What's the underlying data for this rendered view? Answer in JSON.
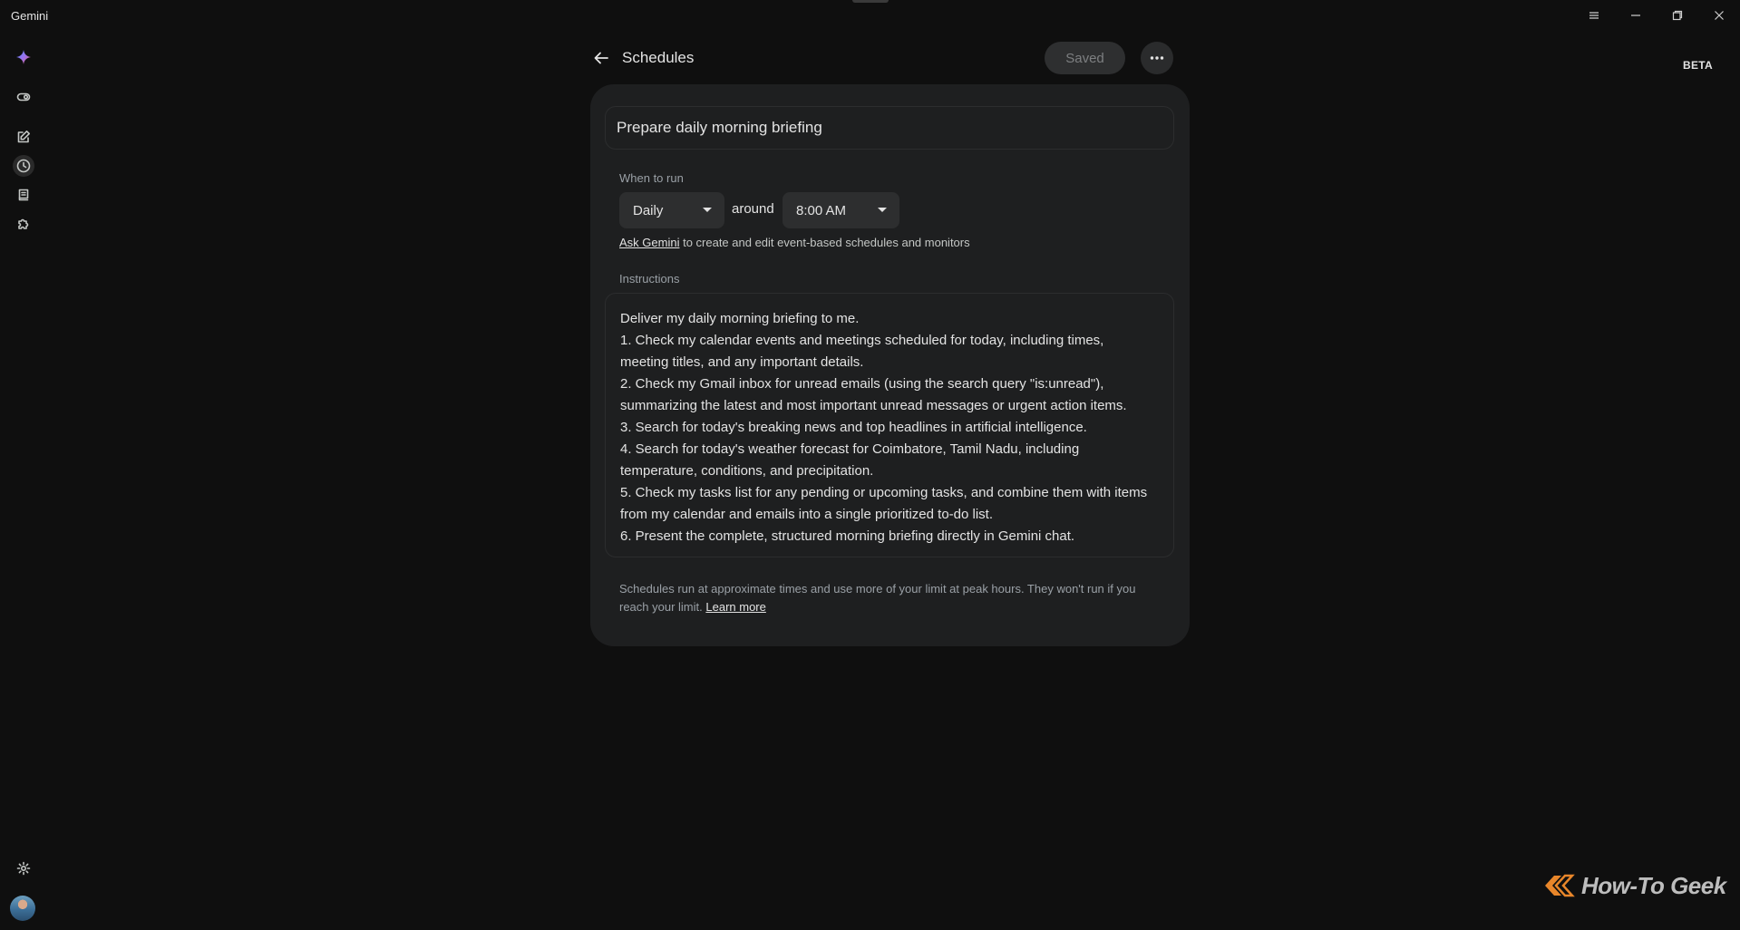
{
  "window": {
    "app_title": "Gemini",
    "controls": [
      "menu-icon",
      "minimize-icon",
      "restore-icon",
      "close-icon"
    ]
  },
  "sidebar": {
    "items": [
      {
        "icon": "gemini-spark-icon"
      },
      {
        "icon": "toggle-icon"
      },
      {
        "icon": "new-chat-icon"
      },
      {
        "icon": "clock-icon",
        "active": true
      },
      {
        "icon": "library-icon"
      },
      {
        "icon": "extensions-icon"
      }
    ],
    "bottom": [
      {
        "icon": "gear-icon"
      },
      {
        "icon": "avatar"
      }
    ]
  },
  "badge": {
    "beta": "BETA"
  },
  "header": {
    "title": "Schedules",
    "saved_label": "Saved"
  },
  "schedule": {
    "name": "Prepare daily morning briefing",
    "when_label": "When to run",
    "frequency": "Daily",
    "around": "around",
    "time": "8:00 AM",
    "hint_link": "Ask Gemini",
    "hint_text": " to create and edit event-based schedules and monitors",
    "instructions_label": "Instructions",
    "instructions": [
      "Deliver my daily morning briefing to me.",
      "1. Check my calendar events and meetings scheduled for today, including times,",
      "meeting titles, and any important details.",
      "2. Check my Gmail inbox for unread emails (using the search query \"is:unread\"),",
      "summarizing the latest and most important unread messages or urgent action items.",
      "3. Search for today's breaking news and top headlines in artificial intelligence.",
      "4. Search for today's weather forecast for Coimbatore, Tamil Nadu, including",
      "temperature, conditions, and precipitation.",
      "5. Check my tasks list for any pending or upcoming tasks, and combine them with items",
      "from my calendar and emails into a single prioritized to-do list.",
      "6. Present the complete, structured morning briefing directly in Gemini chat."
    ],
    "footer_text": "Schedules run at approximate times and use more of your limit at peak hours. They won't run if you reach your limit. ",
    "footer_link": "Learn more"
  },
  "watermark": {
    "text": "How-To Geek",
    "accent": "#e8862a"
  },
  "colors": {
    "background": "#0f0f0f",
    "card": "#1e1f20",
    "field": "#2d2e2f"
  }
}
